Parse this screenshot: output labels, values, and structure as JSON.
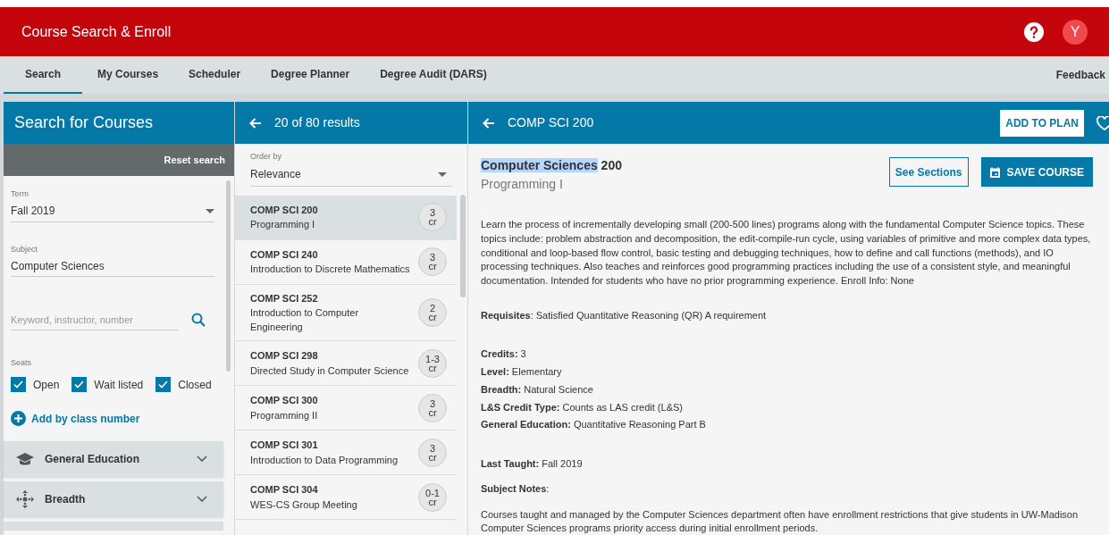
{
  "app_title": "Course Search & Enroll",
  "avatar": "Y",
  "nav_tabs": [
    {
      "label": "Search",
      "selected": true
    },
    {
      "label": "My Courses",
      "selected": false
    },
    {
      "label": "Scheduler",
      "selected": false
    },
    {
      "label": "Degree Planner",
      "selected": false
    },
    {
      "label": "Degree Audit (DARS)",
      "selected": false
    }
  ],
  "feedback": "Feedback",
  "search_panel": {
    "title": "Search for Courses",
    "reset": "Reset search",
    "term": {
      "label": "Term",
      "value": "Fall 2019"
    },
    "subject": {
      "label": "Subject",
      "value": "Computer Sciences"
    },
    "keyword": {
      "placeholder": "Keyword, instructor, number"
    },
    "seats": {
      "label": "Seats",
      "options": [
        {
          "label": "Open",
          "checked": true
        },
        {
          "label": "Wait listed",
          "checked": true
        },
        {
          "label": "Closed",
          "checked": true
        }
      ]
    },
    "add_by_class": "Add by class number",
    "filters": [
      {
        "kind": "education",
        "label": "General Education"
      },
      {
        "kind": "breadth",
        "label": "Breadth"
      }
    ]
  },
  "results_panel": {
    "title": "20 of 80 results",
    "order_by": {
      "label": "Order by",
      "value": "Relevance"
    },
    "courses": [
      {
        "code": "COMP SCI 200",
        "name": "Programming I",
        "credits": "3",
        "unit": "cr",
        "selected": true
      },
      {
        "code": "COMP SCI 240",
        "name": "Introduction to Discrete Mathematics",
        "credits": "3",
        "unit": "cr",
        "selected": false
      },
      {
        "code": "COMP SCI 252",
        "name": "Introduction to Computer Engineering",
        "credits": "2",
        "unit": "cr",
        "selected": false
      },
      {
        "code": "COMP SCI 298",
        "name": "Directed Study in Computer Science",
        "credits": "1-3",
        "unit": "cr",
        "selected": false
      },
      {
        "code": "COMP SCI 300",
        "name": "Programming II",
        "credits": "3",
        "unit": "cr",
        "selected": false
      },
      {
        "code": "COMP SCI 301",
        "name": "Introduction to Data Programming",
        "credits": "3",
        "unit": "cr",
        "selected": false
      },
      {
        "code": "COMP SCI 304",
        "name": "WES-CS Group Meeting",
        "credits": "0-1",
        "unit": "cr",
        "selected": false
      }
    ]
  },
  "detail_panel": {
    "header": "COMP SCI 200",
    "add_to_plan": "ADD TO PLAN",
    "subject": "Computer Sciences",
    "subject_highlighted": true,
    "number": "200",
    "name": "Programming I",
    "see_sections": "See Sections",
    "save_course": "SAVE COURSE",
    "description": "Learn the process of incrementally developing small (200-500 lines) programs along with the fundamental Computer Science topics. These topics include: problem abstraction and decomposition, the edit-compile-run cycle, using variables of primitive and more complex data types, conditional and loop-based flow control, basic testing and debugging techniques, how to define and call functions (methods), and IO processing techniques. Also teaches and reinforces good programming practices including the use of a consistent style, and meaningful documentation. Intended for students who have no prior programming experience. Enroll Info: None",
    "requisites": "**Requisites**: Satisfied Quantitative Reasoning (QR) A requirement",
    "facts": [
      "**Credits:** 3",
      "**Level:** Elementary",
      "**Breadth:** Natural Science",
      "**L&S Credit Type:** Counts as LAS credit (L&S)",
      "**General Education:** Quantitative Reasoning Part B"
    ],
    "last_taught": "**Last Taught:** Fall 2019",
    "subject_notes_label": "**Subject Notes**:",
    "subject_notes": "Courses taught and managed by the Computer Sciences department often have enrollment restrictions that give students in UW-Madison Computer Sciences programs priority access during initial enrollment periods."
  }
}
